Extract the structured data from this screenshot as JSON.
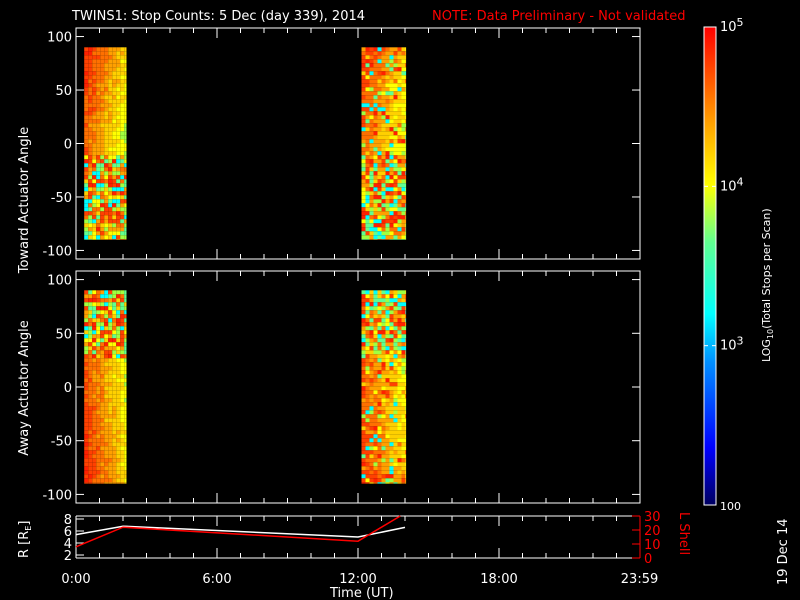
{
  "title": "TWINS1: Stop Counts:  5 Dec (day 339), 2014",
  "note": "NOTE: Data Preliminary - Not validated",
  "footer_date": "19 Dec 14",
  "chart_data": [
    {
      "type": "heatmap",
      "name": "toward",
      "ylabel": "Toward Actuator Angle",
      "ylim": [
        -108,
        108
      ],
      "yticks": [
        "100",
        "50",
        "0",
        "-50",
        "-100"
      ],
      "ytick_values": [
        100,
        50,
        0,
        -50,
        -100
      ],
      "xlim_hours": [
        0,
        24
      ],
      "data_intervals_hours": [
        [
          0.35,
          2.15
        ],
        [
          12.15,
          14.05
        ]
      ],
      "angle_range": [
        -90,
        90
      ]
    },
    {
      "type": "heatmap",
      "name": "away",
      "ylabel": "Away Actuator Angle",
      "ylim": [
        -108,
        108
      ],
      "yticks": [
        "100",
        "50",
        "0",
        "-50",
        "-100"
      ],
      "ytick_values": [
        100,
        50,
        0,
        -50,
        -100
      ],
      "xlim_hours": [
        0,
        24
      ],
      "data_intervals_hours": [
        [
          0.35,
          2.15
        ],
        [
          12.15,
          14.05
        ]
      ],
      "angle_range": [
        -90,
        90
      ]
    },
    {
      "type": "line",
      "name": "orbit",
      "ylabel_left": "R [R",
      "ylabel_left_sub": "E",
      "ylabel_left_end": "]",
      "ylim_left": [
        1.5,
        8.5
      ],
      "yticks_left": [
        "8",
        "6",
        "4",
        "2"
      ],
      "ytick_left_values": [
        8,
        6,
        4,
        2
      ],
      "ylabel_right": "L Shell",
      "ylim_right": [
        0,
        30
      ],
      "yticks_right": [
        "30",
        "20",
        "10",
        "0"
      ],
      "ytick_right_values": [
        30,
        20,
        10,
        0
      ],
      "xlabel": "Time (UT)",
      "xticks": [
        "0:00",
        "6:00",
        "12:00",
        "18:00",
        "23:59"
      ],
      "xtick_values": [
        0,
        6,
        12,
        18,
        23.98
      ],
      "series": [
        {
          "name": "R",
          "axis": "left",
          "color": "#ffffff",
          "x": [
            0,
            2,
            12,
            14
          ],
          "y": [
            5.4,
            6.8,
            5.0,
            6.6
          ]
        },
        {
          "name": "L Shell",
          "axis": "right",
          "color": "#ff0000",
          "x": [
            0,
            2,
            12,
            13.8
          ],
          "y": [
            8,
            22,
            12,
            30
          ]
        }
      ]
    }
  ],
  "colorbar": {
    "label": "LOG",
    "label_sub": "10",
    "label_end": "(Total Stops per Scan)",
    "ticks": [
      {
        "base": "10",
        "exp": "5",
        "value": 100000
      },
      {
        "base": "10",
        "exp": "4",
        "value": 10000
      },
      {
        "base": "10",
        "exp": "3",
        "value": 1000
      }
    ],
    "min_label": "100",
    "range": [
      100,
      100000
    ]
  },
  "colors": {
    "note": "#ff0000",
    "axis": "#ffffff",
    "background": "#000000"
  }
}
